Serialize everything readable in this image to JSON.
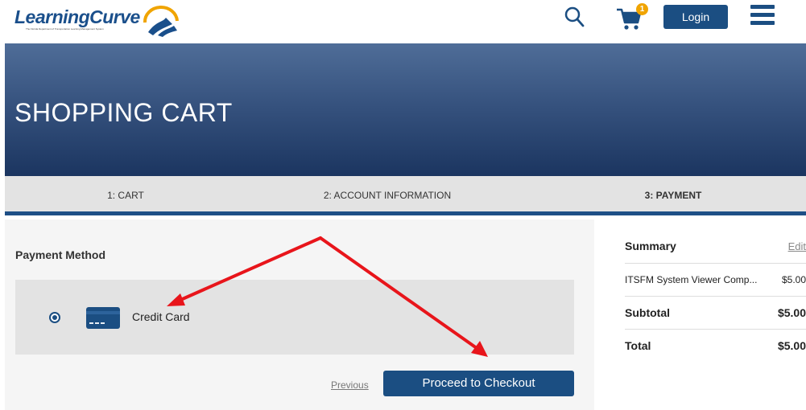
{
  "header": {
    "logo_text": "LearningCurve",
    "logo_tagline": "The Florida Department of Transportation Learning Management System",
    "cart_count": "1",
    "login_label": "Login",
    "brand_color": "#1b4e82"
  },
  "banner": {
    "title": "SHOPPING CART"
  },
  "steps": [
    {
      "label": "1: CART"
    },
    {
      "label": "2: ACCOUNT INFORMATION"
    },
    {
      "label": "3: PAYMENT",
      "active": true
    }
  ],
  "payment": {
    "section_label": "Payment Method",
    "options": [
      {
        "label": "Credit Card",
        "selected": true,
        "icon": "credit-card-icon"
      }
    ],
    "previous_label": "Previous",
    "checkout_label": "Proceed to Checkout"
  },
  "summary": {
    "title": "Summary",
    "edit_label": "Edit",
    "items": [
      {
        "name": "ITSFM System Viewer Comp...",
        "price": "$5.00"
      }
    ],
    "subtotal_label": "Subtotal",
    "subtotal_value": "$5.00",
    "total_label": "Total",
    "total_value": "$5.00"
  },
  "annotation": {
    "arrow_color": "#e8151b"
  }
}
